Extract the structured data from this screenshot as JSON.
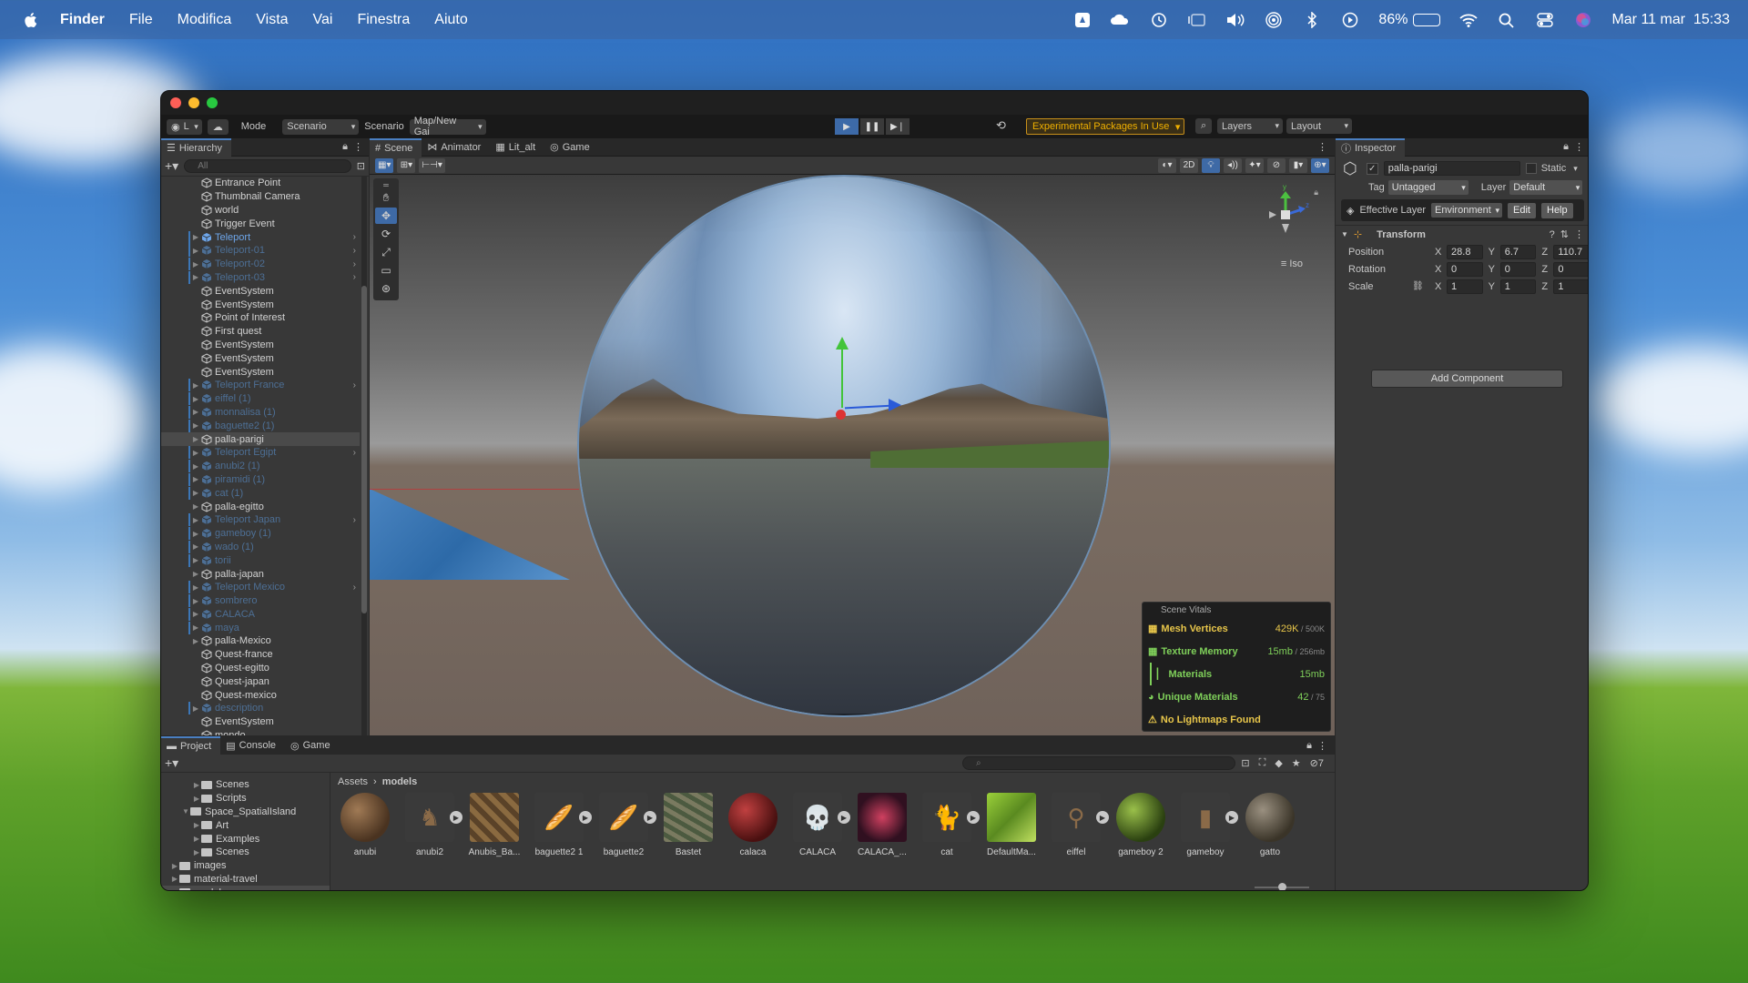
{
  "menubar": {
    "app": "Finder",
    "items": [
      "File",
      "Modifica",
      "Vista",
      "Vai",
      "Finestra",
      "Aiuto"
    ],
    "battery_pct": "86%",
    "battery_level": 0.86,
    "datetime": "Mar 11 mar  15:33"
  },
  "toolbar": {
    "account": "L",
    "mode_label": "Mode",
    "mode_value": "Scenario",
    "scenario_label": "Scenario",
    "scenario_value": "Map/New Gai",
    "experimental": "Experimental Packages In Use",
    "layers": "Layers",
    "layout": "Layout"
  },
  "hierarchy": {
    "title": "Hierarchy",
    "search_placeholder": "All",
    "rows": [
      {
        "label": "Entrance Point",
        "type": "go"
      },
      {
        "label": "Thumbnail Camera",
        "type": "go"
      },
      {
        "label": "world",
        "type": "go"
      },
      {
        "label": "Trigger Event",
        "type": "go"
      },
      {
        "label": "Teleport",
        "type": "prefab",
        "chev": true
      },
      {
        "label": "Teleport-01",
        "type": "disabled",
        "chev": true
      },
      {
        "label": "Teleport-02",
        "type": "disabled",
        "chev": true
      },
      {
        "label": "Teleport-03",
        "type": "disabled",
        "chev": true
      },
      {
        "label": "EventSystem",
        "type": "go"
      },
      {
        "label": "EventSystem",
        "type": "go"
      },
      {
        "label": "Point of Interest",
        "type": "go"
      },
      {
        "label": "First quest",
        "type": "go"
      },
      {
        "label": "EventSystem",
        "type": "go"
      },
      {
        "label": "EventSystem",
        "type": "go"
      },
      {
        "label": "EventSystem",
        "type": "go"
      },
      {
        "label": "Teleport France",
        "type": "disabled",
        "chev": true
      },
      {
        "label": "eiffel (1)",
        "type": "disabled"
      },
      {
        "label": "monnalisa (1)",
        "type": "disabled"
      },
      {
        "label": "baguette2 (1)",
        "type": "disabled"
      },
      {
        "label": "palla-parigi",
        "type": "selected"
      },
      {
        "label": "Teleport Egipt",
        "type": "disabled",
        "chev": true
      },
      {
        "label": "anubi2 (1)",
        "type": "disabled"
      },
      {
        "label": "piramidi (1)",
        "type": "disabled"
      },
      {
        "label": "cat (1)",
        "type": "disabled"
      },
      {
        "label": "palla-egitto",
        "type": "go"
      },
      {
        "label": "Teleport Japan",
        "type": "disabled",
        "chev": true
      },
      {
        "label": "gameboy (1)",
        "type": "disabled"
      },
      {
        "label": "wado (1)",
        "type": "disabled"
      },
      {
        "label": "torii",
        "type": "disabled"
      },
      {
        "label": "palla-japan",
        "type": "go"
      },
      {
        "label": "Teleport Mexico",
        "type": "disabled",
        "chev": true
      },
      {
        "label": "sombrero",
        "type": "disabled"
      },
      {
        "label": "CALACA",
        "type": "disabled"
      },
      {
        "label": "maya",
        "type": "disabled"
      },
      {
        "label": "palla-Mexico",
        "type": "go"
      },
      {
        "label": "Quest-france",
        "type": "go"
      },
      {
        "label": "Quest-egitto",
        "type": "go"
      },
      {
        "label": "Quest-japan",
        "type": "go"
      },
      {
        "label": "Quest-mexico",
        "type": "go"
      },
      {
        "label": "description",
        "type": "disabled"
      },
      {
        "label": "EventSystem",
        "type": "go"
      },
      {
        "label": "mondo",
        "type": "go"
      }
    ]
  },
  "scene": {
    "tabs": [
      "Scene",
      "Animator",
      "Lit_alt",
      "Game"
    ],
    "btn_2d": "2D",
    "iso_label": "Iso",
    "gizmo_y": "y",
    "gizmo_z": "z",
    "vitals": {
      "title": "Scene Vitals",
      "rows": [
        {
          "label": "Mesh Vertices",
          "value": "429K",
          "sub": " / 500K",
          "color": "#e8c64a"
        },
        {
          "label": "Texture Memory",
          "value": "15mb",
          "sub": " / 256mb",
          "color": "#7fd05a"
        },
        {
          "label": "Materials",
          "value": "15mb",
          "sub": "",
          "color": "#7fd05a"
        },
        {
          "label": "Unique Materials",
          "value": "42",
          "sub": " / 75",
          "color": "#7fd05a"
        },
        {
          "label": "No Lightmaps Found",
          "value": "",
          "sub": "",
          "color": "#e8c64a"
        }
      ]
    }
  },
  "inspector": {
    "title": "Inspector",
    "object_name": "palla-parigi",
    "static_label": "Static",
    "tag_label": "Tag",
    "tag_value": "Untagged",
    "layer_label": "Layer",
    "layer_value": "Default",
    "effective_layer_label": "Effective Layer",
    "effective_layer_value": "Environment",
    "edit": "Edit",
    "help": "Help",
    "transform_title": "Transform",
    "position_label": "Position",
    "rotation_label": "Rotation",
    "scale_label": "Scale",
    "axis_x": "X",
    "axis_y": "Y",
    "axis_z": "Z",
    "position": {
      "x": "28.8",
      "y": "6.7",
      "z": "110.7"
    },
    "rotation": {
      "x": "0",
      "y": "0",
      "z": "0"
    },
    "scale": {
      "x": "1",
      "y": "1",
      "z": "1"
    },
    "add_component": "Add Component"
  },
  "project": {
    "tabs": [
      "Project",
      "Console",
      "Game"
    ],
    "hidden_count": "7",
    "breadcrumb": [
      "Assets",
      "models"
    ],
    "tree": [
      {
        "label": "Scenes",
        "indent": 2
      },
      {
        "label": "Scripts",
        "indent": 2
      },
      {
        "label": "Space_SpatialIsland",
        "indent": 1,
        "open": true
      },
      {
        "label": "Art",
        "indent": 2
      },
      {
        "label": "Examples",
        "indent": 2
      },
      {
        "label": "Scenes",
        "indent": 2
      },
      {
        "label": "images",
        "indent": 0
      },
      {
        "label": "material-travel",
        "indent": 0
      },
      {
        "label": "models",
        "indent": 0,
        "selected": true
      }
    ],
    "assets": [
      {
        "label": "anubi",
        "bg": "radial-gradient(circle at 35% 35%, #a07a55, #4a3320 70%)",
        "ball": true
      },
      {
        "label": "anubi2",
        "bg": "#3a3a3a",
        "play": true,
        "icon": "♞"
      },
      {
        "label": "Anubis_Ba...",
        "bg": "repeating-linear-gradient(45deg,#8a6a40 0 6px,#5a4228 6px 12px)"
      },
      {
        "label": "baguette2 1",
        "bg": "#3a3a3a",
        "play": true,
        "icon": "🥖"
      },
      {
        "label": "baguette2",
        "bg": "#3a3a3a",
        "play": true,
        "icon": "🥖"
      },
      {
        "label": "Bastet",
        "bg": "repeating-linear-gradient(30deg,#7a7a60 0 5px,#4c5a40 5px 10px)"
      },
      {
        "label": "calaca",
        "bg": "radial-gradient(circle at 35% 35%, #c04040, #4a1010 70%)",
        "ball": true
      },
      {
        "label": "CALACA",
        "bg": "#3a3a3a",
        "play": true,
        "icon": "💀"
      },
      {
        "label": "CALACA_...",
        "bg": "radial-gradient(circle at 50% 50%, #d04060, #301020 70%)"
      },
      {
        "label": "cat",
        "bg": "#3a3a3a",
        "play": true,
        "icon": "🐈"
      },
      {
        "label": "DefaultMa...",
        "bg": "linear-gradient(135deg,#9ad03a,#5a8a20 50%,#c0e060)"
      },
      {
        "label": "eiffel",
        "bg": "#3a3a3a",
        "play": true,
        "icon": "⚲"
      },
      {
        "label": "gameboy 2",
        "bg": "radial-gradient(circle at 35% 35%, #9ac04a, #2a4010 70%)",
        "ball": true
      },
      {
        "label": "gameboy",
        "bg": "#3a3a3a",
        "play": true,
        "icon": "▮"
      },
      {
        "label": "gatto",
        "bg": "radial-gradient(circle at 35% 35%, #9a9080, #3a3428 70%)",
        "ball": true
      }
    ]
  }
}
